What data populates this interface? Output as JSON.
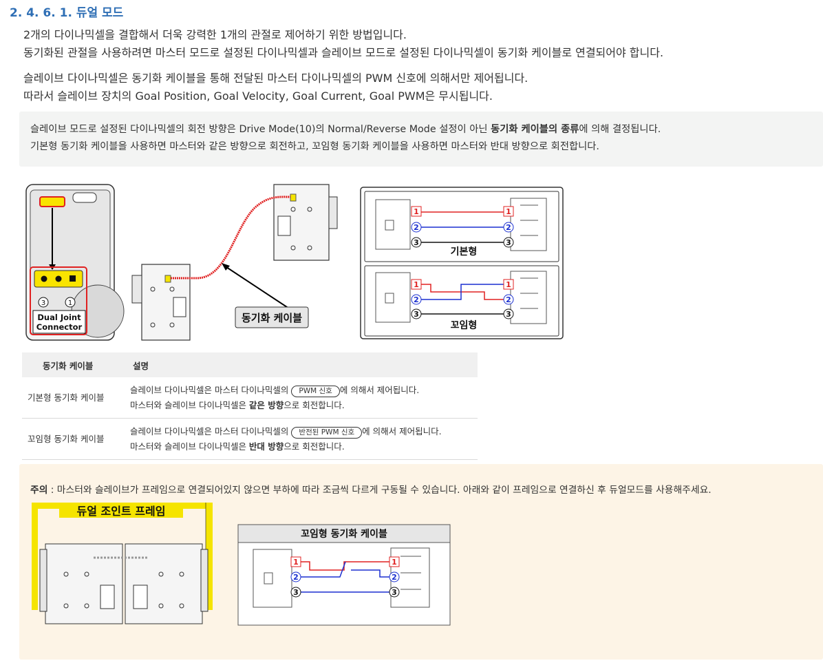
{
  "heading": "2. 4. 6. 1. 듀얼 모드",
  "paragraphs": [
    "2개의 다이나믹셀을 결합해서 더욱 강력한 1개의 관절로 제어하기 위한 방법입니다.",
    "동기화된 관절을 사용하려면 마스터 모드로 설정된 다이나믹셀과 슬레이브 모드로 설정된 다이나믹셀이 동기화 케이블로 연결되어야 합니다.",
    "슬레이브 다이나믹셀은 동기화 케이블을 통해 전달된 마스터 다이나믹셀의 PWM 신호에 의해서만 제어됩니다.",
    "따라서 슬레이브 장치의 Goal Position, Goal Velocity, Goal Current, Goal PWM은 무시됩니다."
  ],
  "note": {
    "line1_a": "슬레이브 모드로 설정된 다이나믹셀의 회전 방향은 Drive Mode(10)의 Normal/Reverse Mode 설정이 아닌 ",
    "line1_bold": "동기화 케이블의 종류",
    "line1_b": "에 의해 결정됩니다.",
    "line2": "기본형 동기화 케이블을 사용하면 마스터와 같은 방향으로 회전하고, 꼬임형 동기화 케이블을 사용하면 마스터와 반대 방향으로 회전합니다."
  },
  "figure1": {
    "connector_label_1": "Dual Joint",
    "connector_label_2": "Connector",
    "pin3": "3",
    "pin1": "1",
    "cable_label": "동기화 케이블",
    "basic_label": "기본형",
    "twisted_label": "꼬임형",
    "n1": "1",
    "n2": "2",
    "n3": "3"
  },
  "table": {
    "headers": [
      "동기화 케이블",
      "설명"
    ],
    "rows": [
      {
        "name": "기본형 동기화 케이블",
        "line1_a": "슬레이브 다이나믹셀은 마스터 다이나믹셀의 ",
        "signal": "PWM 신호",
        "line1_b": "에 의해서 제어됩니다.",
        "line2_a": "마스터와 슬레이브 다이나믹셀은 ",
        "line2_bold": "같은 방향",
        "line2_b": "으로 회전합니다."
      },
      {
        "name": "꼬임형 동기화 케이블",
        "line1_a": "슬레이브 다이나믹셀은 마스터 다이나믹셀의 ",
        "signal": "반전된 PWM 신호",
        "line1_b": "에 의해서 제어됩니다.",
        "line2_a": "마스터와 슬레이브 다이나믹셀은 ",
        "line2_bold": "반대 방향",
        "line2_b": "으로 회전합니다."
      }
    ]
  },
  "warning": {
    "label": "주의",
    "text": " : 마스터와 슬레이브가 프레임으로 연결되어있지 않으면 부하에 따라 조금씩 다르게 구동될 수 있습니다. 아래와 같이 프레임으로 연결하신 후 듀얼모드를 사용해주세요.",
    "frame_label": "듀얼 조인트 프레임",
    "twisted_cable_title": "꼬임형 동기화 케이블",
    "n1": "1",
    "n2": "2",
    "n3": "3"
  },
  "colors": {
    "heading": "#2f6fb5",
    "red_wire": "#e02020",
    "blue_wire": "#1a2fd0",
    "frame_yellow": "#f5e400",
    "warn_bg": "#fdf4e6",
    "note_bg": "#f3f4f3"
  }
}
